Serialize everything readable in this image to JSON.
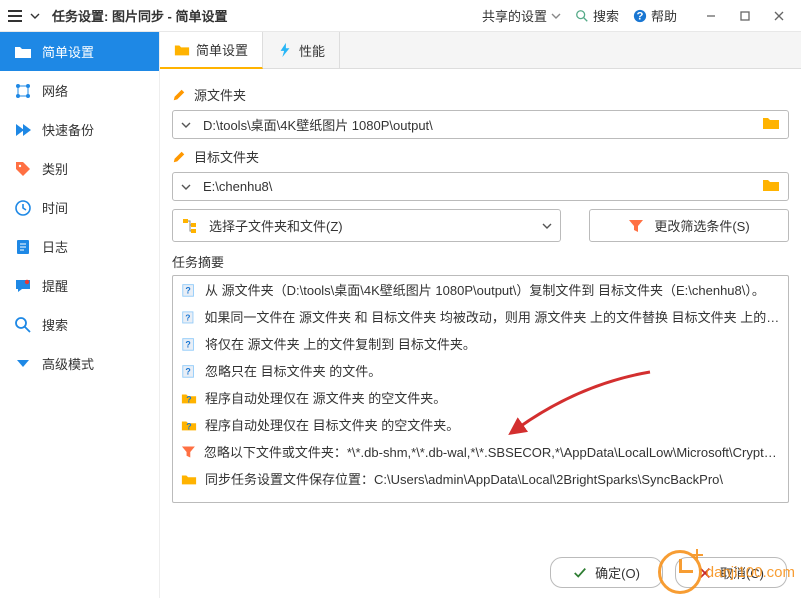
{
  "titlebar": {
    "title": "任务设置: 图片同步 - 简单设置",
    "shared": "共享的设置",
    "search": "搜索",
    "help": "帮助"
  },
  "sidebar": {
    "items": [
      {
        "label": "简单设置"
      },
      {
        "label": "网络"
      },
      {
        "label": "快速备份"
      },
      {
        "label": "类别"
      },
      {
        "label": "时间"
      },
      {
        "label": "日志"
      },
      {
        "label": "提醒"
      },
      {
        "label": "搜索"
      },
      {
        "label": "高级模式"
      }
    ]
  },
  "tabs": {
    "simple": "简单设置",
    "perf": "性能"
  },
  "labels": {
    "source": "源文件夹",
    "dest": "目标文件夹",
    "summary": "任务摘要"
  },
  "paths": {
    "source": "D:\\tools\\桌面\\4K壁纸图片 1080P\\output\\",
    "dest": "E:\\chenhu8\\"
  },
  "buttons": {
    "choose": "选择子文件夹和文件(Z)",
    "filter": "更改筛选条件(S)",
    "ok": "确定(O)",
    "cancel": "取消(C)"
  },
  "summary": [
    "从 源文件夹（D:\\tools\\桌面\\4K壁纸图片 1080P\\output\\）复制文件到 目标文件夹（E:\\chenhu8\\）。",
    "如果同一文件在 源文件夹 和 目标文件夹 均被改动，则用 源文件夹 上的文件替换 目标文件夹 上的文件...",
    "将仅在 源文件夹 上的文件复制到 目标文件夹。",
    "忽略只在 目标文件夹 的文件。",
    "程序自动处理仅在 源文件夹 的空文件夹。",
    "程序自动处理仅在 目标文件夹 的空文件夹。",
    "忽略以下文件或文件夹：*\\*.db-shm,*\\*.db-wal,*\\*.SBSECOR,*\\AppData\\LocalLow\\Microsoft\\CryptnetUrlCa...",
    "同步任务设置文件保存位置：C:\\Users\\admin\\AppData\\Local\\2BrightSparks\\SyncBackPro\\"
  ],
  "watermark": "danji100.com"
}
